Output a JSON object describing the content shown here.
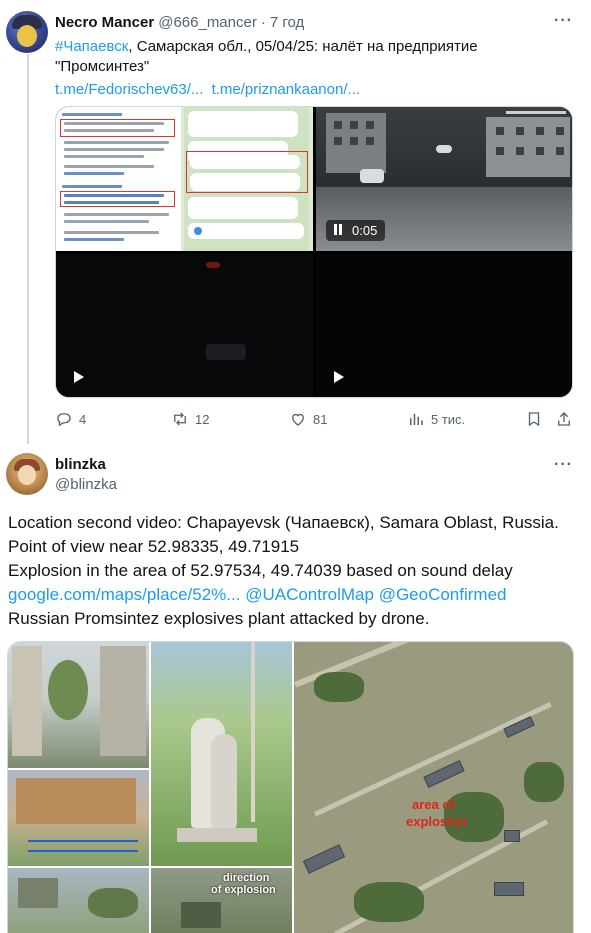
{
  "post1": {
    "name": "Necro Mancer",
    "handle": "@666_mancer",
    "separator": "·",
    "time": "7 год",
    "hashtag": "#Чапаевск",
    "text_line1_rest": ", Самарская обл., 05/04/25: налёт на предприятие",
    "text_line2": "\"Промсинтез\"",
    "link1": "t.me/Fedorischev63/...",
    "link2": "t.me/priznankaanon/...",
    "video_duration": "0:05",
    "actions": {
      "replies": "4",
      "reposts": "12",
      "likes": "81",
      "views": "5 тис."
    }
  },
  "post2": {
    "name": "blinzka",
    "handle": "@blinzka",
    "lines": [
      "Location second video: Chapayevsk (Чапаевск), Samara Oblast, Russia.",
      "Point of view near 52.98335, 49.71915",
      "Explosion in the area of 52.97534, 49.74039 based on sound delay"
    ],
    "link_line": {
      "url": "google.com/maps/place/52%...",
      "mention1": "@UAControlMap",
      "mention2": "@GeoConfirmed"
    },
    "last_line": "Russian Promsintez explosives plant attacked by drone.",
    "map_labels": {
      "area": "area of",
      "explosion": "explosion",
      "direction": "direction",
      "of_explosion": "of explosion"
    }
  },
  "colors": {
    "link": "#1d9bf0",
    "text": "#0f1419",
    "muted": "#536471",
    "annotation_red": "#e0241c"
  },
  "icons": [
    "more-icon",
    "reply-icon",
    "repost-icon",
    "like-icon",
    "views-icon",
    "bookmark-icon",
    "share-icon",
    "play-icon",
    "pause-icon"
  ]
}
